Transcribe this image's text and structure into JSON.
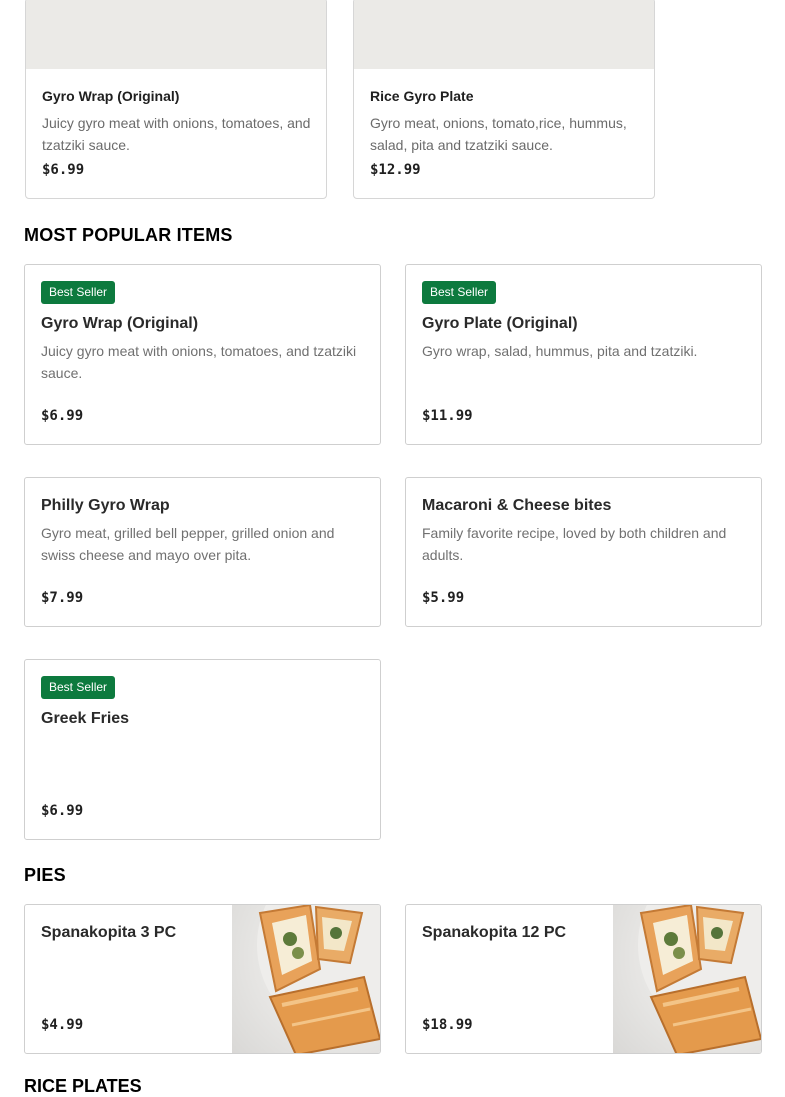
{
  "featured": [
    {
      "title": "Gyro Wrap (Original)",
      "desc": "Juicy gyro meat with onions, tomatoes, and tzatziki sauce.",
      "price": "$6.99"
    },
    {
      "title": "Rice Gyro Plate",
      "desc": "Gyro meat, onions, tomato,rice, hummus, salad, pita and tzatziki sauce.",
      "price": "$12.99"
    }
  ],
  "popular": {
    "heading": "MOST POPULAR ITEMS",
    "items": [
      {
        "badge": "Best Seller",
        "title": "Gyro Wrap (Original)",
        "desc": "Juicy gyro meat with onions, tomatoes, and tzatziki sauce.",
        "price": "$6.99"
      },
      {
        "badge": "Best Seller",
        "title": "Gyro Plate (Original)",
        "desc": "Gyro wrap, salad, hummus, pita and tzatziki.",
        "price": "$11.99"
      },
      {
        "title": "Philly Gyro Wrap",
        "desc": "Gyro meat, grilled bell pepper, grilled onion and swiss cheese and mayo over pita.",
        "price": "$7.99"
      },
      {
        "title": "Macaroni & Cheese bites",
        "desc": "Family favorite recipe, loved by both children and adults.",
        "price": "$5.99"
      },
      {
        "badge": "Best Seller",
        "title": "Greek Fries",
        "price": "$6.99"
      }
    ]
  },
  "pies": {
    "heading": "PIES",
    "items": [
      {
        "title": "Spanakopita 3 PC",
        "price": "$4.99"
      },
      {
        "title": "Spanakopita 12 PC",
        "price": "$18.99"
      }
    ]
  },
  "next_section": {
    "heading": "RICE PLATES"
  }
}
